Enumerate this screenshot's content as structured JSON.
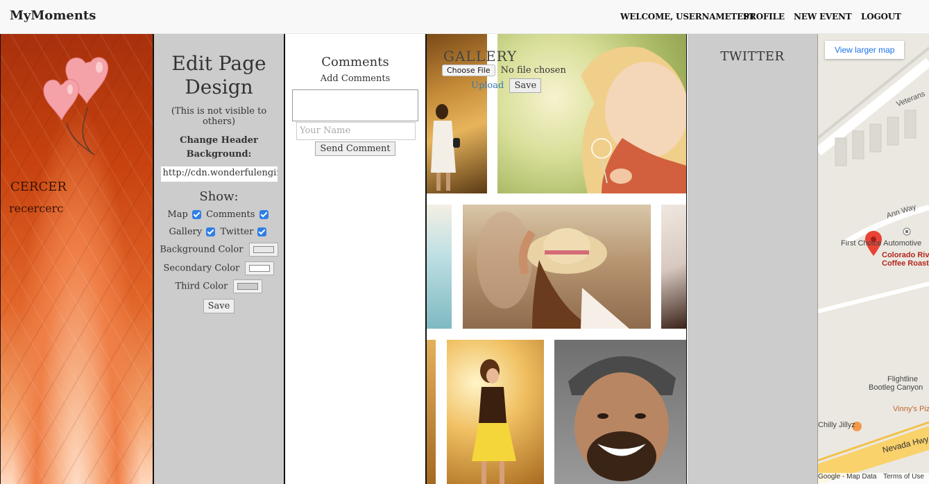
{
  "app": {
    "brand": "MyMoments"
  },
  "nav": {
    "links": [
      {
        "label": "WELCOME, USERNAMETEST"
      },
      {
        "label": "PROFILE"
      },
      {
        "label": "NEW EVENT"
      },
      {
        "label": "LOGOUT"
      }
    ]
  },
  "event": {
    "title": "CERCER",
    "subtitle": "recercerc"
  },
  "edit": {
    "title": "Edit Page Design",
    "note": "(This is not visible to others)",
    "header_label": "Change Header Background:",
    "header_url": "http://cdn.wonderfulengin",
    "show_label": "Show:",
    "opt_map": "Map",
    "opt_comments": "Comments",
    "opt_gallery": "Gallery",
    "opt_twitter": "Twitter",
    "bg_color_label": "Background Color",
    "secondary_color_label": "Secondary Color",
    "third_color_label": "Third Color",
    "save_label": "Save",
    "colors": {
      "background": "#e8e8e8",
      "secondary": "#ffffff",
      "third": "#cccccc"
    }
  },
  "comments": {
    "title": "Comments",
    "add_label": "Add Comments",
    "name_placeholder": "Your Name",
    "send_label": "Send Comment"
  },
  "gallery": {
    "title": "GALLERY",
    "choose_file_label": "Choose File",
    "no_file_text": "No file chosen",
    "upload_label": "Upload",
    "save_label": "Save"
  },
  "twitter": {
    "title": "TWITTER"
  },
  "map": {
    "larger_map_label": "View larger map",
    "labels": [
      "Veterans",
      "Ann Way",
      "First Choice Automotive",
      "Colorado River",
      "Coffee Roasters",
      "Flightline",
      "Bootleg Canyon",
      "Vinny's Pizza",
      "Chilly Jillyz",
      "Nevada Hwy"
    ],
    "footer_left": "Google - Map Data",
    "footer_right": "Terms of Use"
  }
}
